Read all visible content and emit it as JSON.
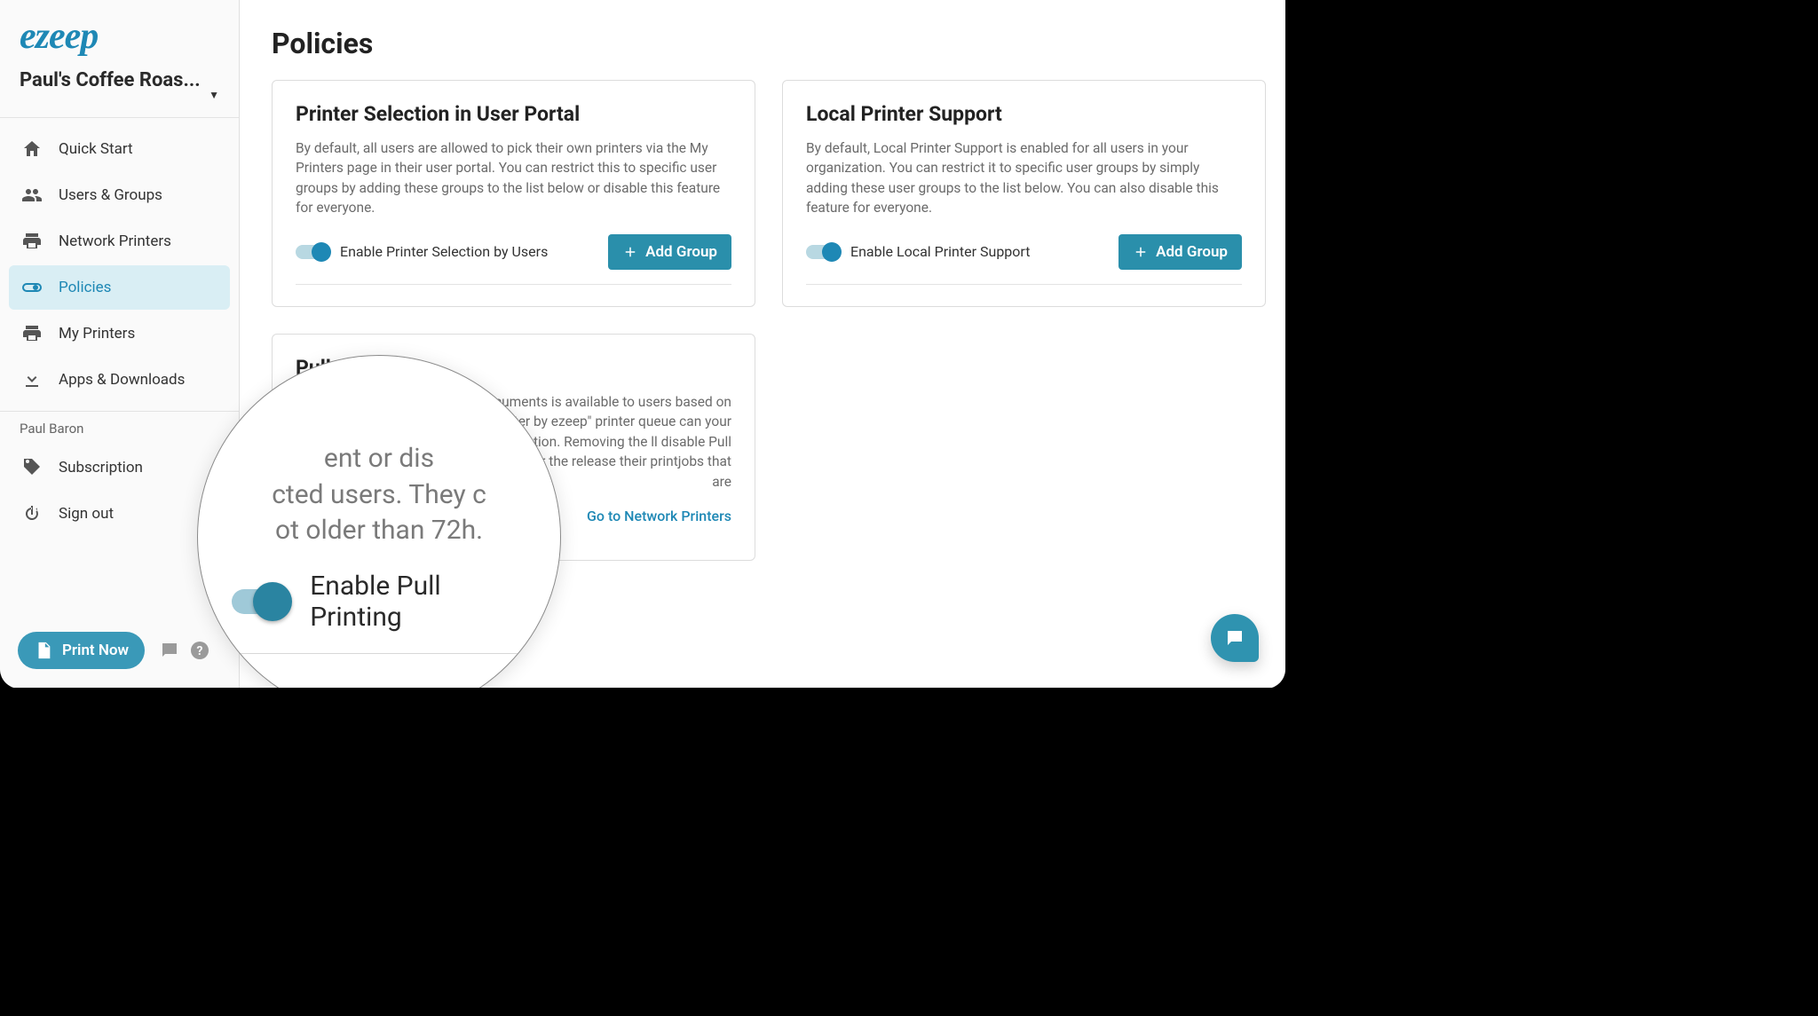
{
  "brand": {
    "name": "ezeep"
  },
  "org": {
    "name": "Paul's Coffee Roas..."
  },
  "sidebar": {
    "items": [
      {
        "icon": "home",
        "label": "Quick Start"
      },
      {
        "icon": "users",
        "label": "Users & Groups"
      },
      {
        "icon": "printer",
        "label": "Network Printers"
      },
      {
        "icon": "toggle",
        "label": "Policies",
        "active": true
      },
      {
        "icon": "printer2",
        "label": "My Printers"
      },
      {
        "icon": "download",
        "label": "Apps & Downloads"
      }
    ],
    "user_label": "Paul Baron",
    "items2": [
      {
        "icon": "tag",
        "label": "Subscription"
      },
      {
        "icon": "power",
        "label": "Sign out"
      }
    ],
    "print_now": "Print Now"
  },
  "page": {
    "title": "Policies",
    "card1": {
      "title": "Printer Selection in User Portal",
      "desc": "By default, all users are allowed to pick their own printers via the My Printers page in their user portal. You can restrict this to specific user groups by adding these groups to the list below or disable this feature for everyone.",
      "toggle_label": "Enable Printer Selection by Users",
      "button": "Add Group"
    },
    "card2": {
      "title": "Local Printer Support",
      "desc": "By default, Local Printer Support is enabled for all users in your organization. You can restrict it to specific user groups by simply adding these user groups to the list below. You can also disable this feature for everyone.",
      "toggle_label": "Enable Local Printer Support",
      "button": "Add Group"
    },
    "card3": {
      "title": "Pull Printing",
      "desc_partial_right": "ocuments is available to users based on Printer by ezeep\" printer queue can your organization. Removing the ll disable Pull Printing for the release their printjobs that are",
      "link": "Go to Network Printers"
    }
  },
  "zoom": {
    "line1": "ent or dis",
    "line2": "cted users. They c",
    "line3": "ot older than 72h.",
    "toggle_label": "Enable Pull Printing"
  }
}
